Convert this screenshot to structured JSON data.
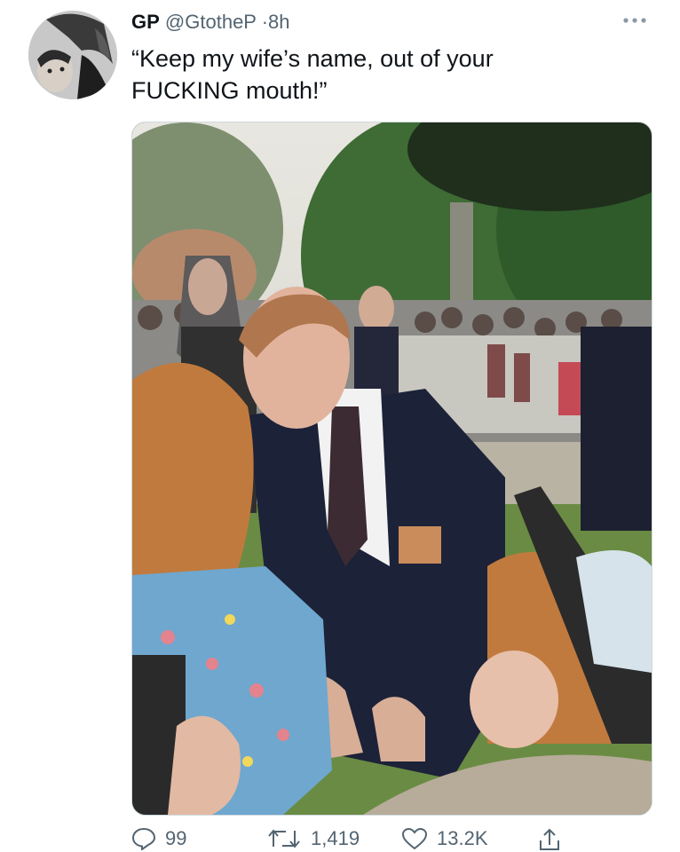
{
  "tweet": {
    "display_name": "GP",
    "handle": "@GtotheP",
    "separator": "·",
    "time": "8h",
    "text": "“Keep my wife’s name, out of your\nFUCKING mouth!”"
  },
  "actions": {
    "replies": "99",
    "retweets": "1,419",
    "likes": "13.2K"
  },
  "icons": {
    "more": "more-horizontal-icon",
    "reply": "comment-icon",
    "retweet": "retweet-icon",
    "like": "heart-icon",
    "share": "share-icon"
  },
  "colors": {
    "text_primary": "#0f1419",
    "text_secondary": "#536471",
    "border": "#cfd9de"
  }
}
